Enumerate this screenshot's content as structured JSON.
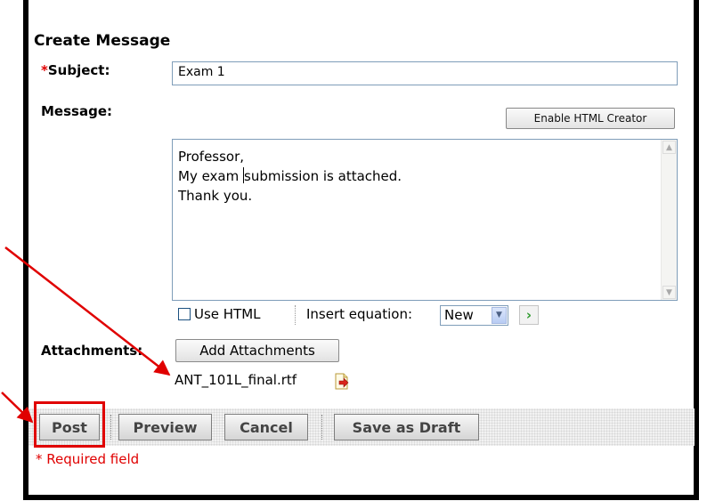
{
  "form": {
    "title": "Create Message",
    "subject_star": "*",
    "subject_label": "Subject:",
    "subject_value": "Exam 1",
    "message_label": "Message:",
    "html_creator_label": "Enable HTML Creator",
    "message_lines": [
      "Professor,",
      "My exam ",
      "submission is attached.",
      "Thank you."
    ],
    "use_html_label": "Use HTML",
    "insert_equation_label": "Insert equation:",
    "equation_selected": "New",
    "attachments_label": "Attachments:",
    "add_attachments_label": "Add Attachments",
    "attachment_file": "ANT_101L_final.rtf"
  },
  "actions": {
    "post": "Post",
    "preview": "Preview",
    "cancel": "Cancel",
    "save_draft": "Save as Draft"
  },
  "required_note": "* Required field",
  "colors": {
    "annotation": "#e00000",
    "required": "#e00000",
    "go_arrow": "#2e9a2e"
  },
  "icons": {
    "go": "chevron-right-icon",
    "file": "file-remove-icon",
    "dropdown": "chevron-down-icon"
  }
}
